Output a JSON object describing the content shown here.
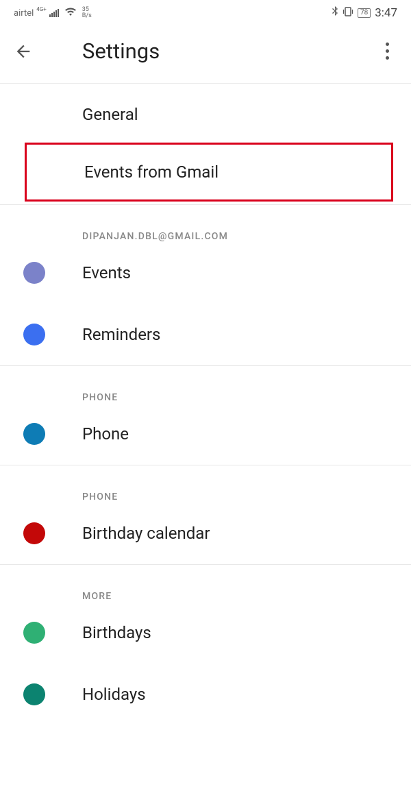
{
  "statusbar": {
    "carrier": "airtel",
    "network_badge": "4G+",
    "speed_num": "35",
    "speed_unit": "B/s",
    "battery": "78",
    "time": "3:47"
  },
  "header": {
    "title": "Settings"
  },
  "top_items": {
    "general": "General",
    "events_from_gmail": "Events from Gmail"
  },
  "sections": [
    {
      "header": "DIPANJAN.DBL@GMAIL.COM",
      "items": [
        {
          "label": "Events",
          "color": "#7b82c9"
        },
        {
          "label": "Reminders",
          "color": "#3b6ff0"
        }
      ]
    },
    {
      "header": "PHONE",
      "items": [
        {
          "label": "Phone",
          "color": "#0e7cb5"
        }
      ]
    },
    {
      "header": "PHONE",
      "items": [
        {
          "label": "Birthday calendar",
          "color": "#c30808"
        }
      ]
    },
    {
      "header": "MORE",
      "items": [
        {
          "label": "Birthdays",
          "color": "#2fb074"
        },
        {
          "label": "Holidays",
          "color": "#0c8370"
        }
      ]
    }
  ]
}
